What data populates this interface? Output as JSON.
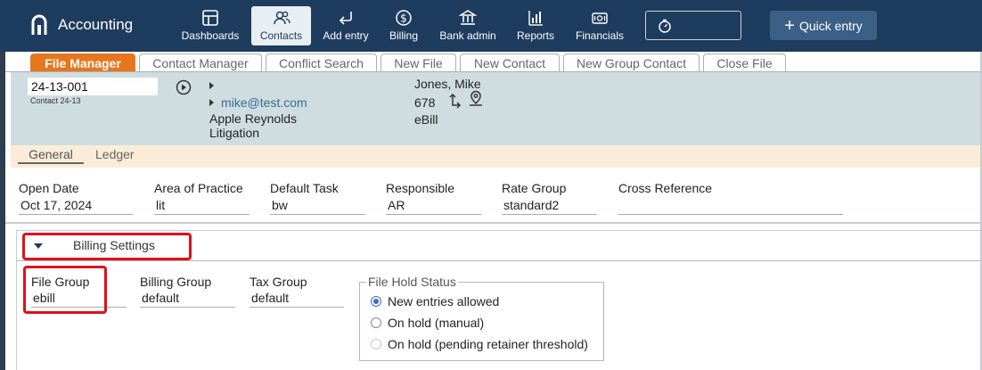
{
  "app": {
    "title": "Accounting"
  },
  "nav": [
    {
      "label": "Dashboards",
      "icon": "dashboard-icon"
    },
    {
      "label": "Contacts",
      "icon": "contacts-icon",
      "active": true
    },
    {
      "label": "Add entry",
      "icon": "add-entry-icon"
    },
    {
      "label": "Billing",
      "icon": "billing-icon"
    },
    {
      "label": "Bank admin",
      "icon": "bank-icon"
    },
    {
      "label": "Reports",
      "icon": "reports-icon"
    },
    {
      "label": "Financials",
      "icon": "financials-icon"
    }
  ],
  "quick_entry": {
    "label": "Quick entry"
  },
  "tabs": [
    "File Manager",
    "Contact Manager",
    "Conflict Search",
    "New File",
    "New Contact",
    "New Group Contact",
    "Close File"
  ],
  "file": {
    "number": "24-13-001",
    "contact_note": "Contact 24-13",
    "email": "mike@test.com",
    "client": "Apple Reynolds",
    "matter_type": "Litigation",
    "contact_name": "Jones, Mike",
    "code": "678",
    "billing_type": "eBill"
  },
  "subtabs": [
    "General",
    "Ledger"
  ],
  "general": [
    {
      "label": "Open Date",
      "value": "Oct 17, 2024"
    },
    {
      "label": "Area of Practice",
      "value": "lit"
    },
    {
      "label": "Default Task",
      "value": "bw"
    },
    {
      "label": "Responsible",
      "value": "AR"
    },
    {
      "label": "Rate Group",
      "value": "standard2"
    },
    {
      "label": "Cross Reference",
      "value": ""
    }
  ],
  "billing": {
    "section_title": "Billing Settings",
    "fields": [
      {
        "label": "File Group",
        "value": "ebill"
      },
      {
        "label": "Billing Group",
        "value": "default"
      },
      {
        "label": "Tax Group",
        "value": "default"
      }
    ],
    "hold_status": {
      "legend": "File Hold Status",
      "options": [
        {
          "label": "New entries allowed",
          "selected": true,
          "disabled": false
        },
        {
          "label": "On hold (manual)",
          "selected": false,
          "disabled": false
        },
        {
          "label": "On hold (pending retainer threshold)",
          "selected": false,
          "disabled": true
        }
      ]
    }
  },
  "colors": {
    "topbar": "#1e3c5e",
    "active_tab": "#e8761c",
    "header_bg": "#cfdde0",
    "highlight": "#e0101a"
  }
}
